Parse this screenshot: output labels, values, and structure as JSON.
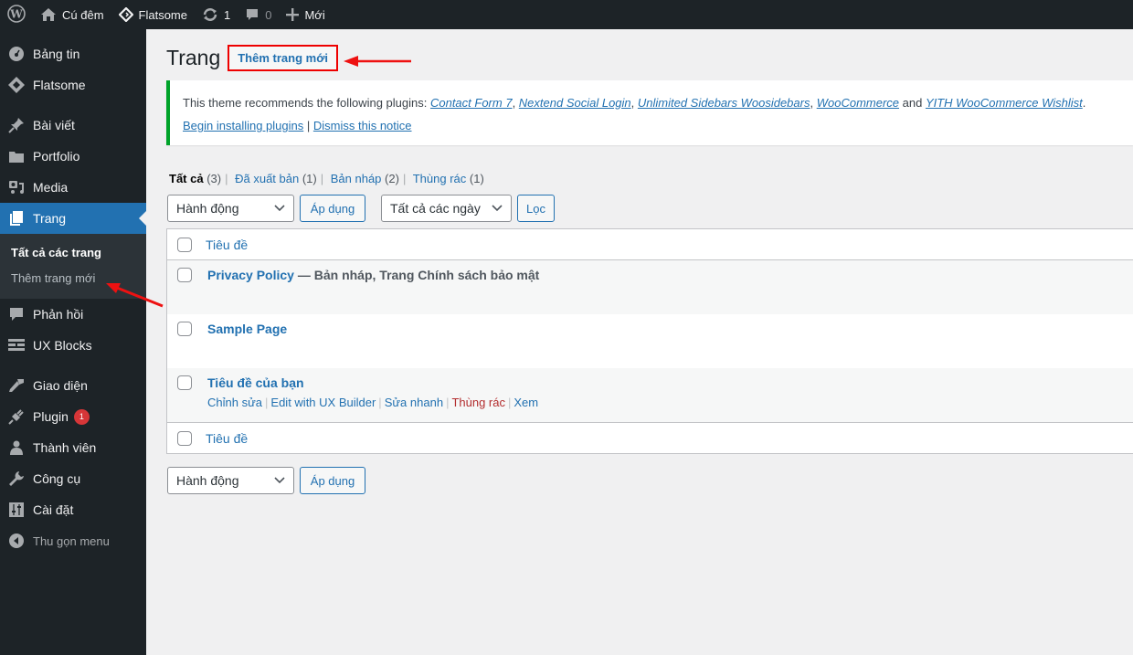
{
  "adminbar": {
    "wp_logo": "wordpress-logo-icon",
    "site_name": "Cú đêm",
    "theme_name": "Flatsome",
    "updates_count": "1",
    "comments_count": "0",
    "new_label": "Mới"
  },
  "sidebar": {
    "items": [
      {
        "label": "Bảng tin",
        "icon": "dashboard-icon"
      },
      {
        "label": "Flatsome",
        "icon": "flatsome-icon"
      },
      {
        "label": "Bài viết",
        "icon": "pin-icon"
      },
      {
        "label": "Portfolio",
        "icon": "folder-icon"
      },
      {
        "label": "Media",
        "icon": "media-icon"
      },
      {
        "label": "Trang",
        "icon": "page-icon",
        "active": true
      },
      {
        "label": "Phản hồi",
        "icon": "comment-icon"
      },
      {
        "label": "UX Blocks",
        "icon": "blocks-icon"
      },
      {
        "label": "Giao diện",
        "icon": "brush-icon"
      },
      {
        "label": "Plugin",
        "icon": "plugin-icon",
        "badge": "1"
      },
      {
        "label": "Thành viên",
        "icon": "user-icon"
      },
      {
        "label": "Công cụ",
        "icon": "wrench-icon"
      },
      {
        "label": "Cài đặt",
        "icon": "settings-icon"
      }
    ],
    "submenu": {
      "all_pages": "Tất cả các trang",
      "add_new": "Thêm trang mới"
    },
    "collapse_label": "Thu gọn menu"
  },
  "main": {
    "title": "Trang",
    "add_new_label": "Thêm trang mới",
    "notice": {
      "intro": "This theme recommends the following plugins: ",
      "plugins": [
        "Contact Form 7",
        "Nextend Social Login",
        "Unlimited Sidebars Woosidebars",
        "WooCommerce",
        "YITH WooCommerce Wishlist"
      ],
      "sep1": ", ",
      "and": " and ",
      "end": ".",
      "begin_installing": "Begin installing plugins",
      "divider": " | ",
      "dismiss": "Dismiss this notice"
    },
    "views": [
      {
        "label": "Tất cả",
        "count": "(3)",
        "current": true
      },
      {
        "label": "Đã xuất bản",
        "count": "(1)"
      },
      {
        "label": "Bản nháp",
        "count": "(2)"
      },
      {
        "label": "Thùng rác",
        "count": "(1)"
      }
    ],
    "bulk_action": {
      "selected": "Hành động",
      "apply": "Áp dụng"
    },
    "date_filter": {
      "selected": "Tất cả các ngày",
      "filter": "Lọc"
    },
    "table": {
      "column_title": "Tiêu đề",
      "rows": [
        {
          "title": "Privacy Policy",
          "state": " — Bản nháp, Trang Chính sách bảo mật"
        },
        {
          "title": "Sample Page",
          "state": ""
        },
        {
          "title": "Tiêu đề của bạn",
          "state": "",
          "actions": [
            "Chỉnh sửa",
            "Edit with UX Builder",
            "Sửa nhanh",
            "Thùng rác",
            "Xem"
          ]
        }
      ]
    },
    "bottom_bulk_action": {
      "selected": "Hành động",
      "apply": "Áp dụng"
    }
  },
  "colors": {
    "admin_dark": "#1d2327",
    "accent": "#2271b1",
    "notice_success": "#00a32a",
    "badge": "#d63638",
    "annotation": "#ff0000",
    "trash": "#b32d2e"
  }
}
